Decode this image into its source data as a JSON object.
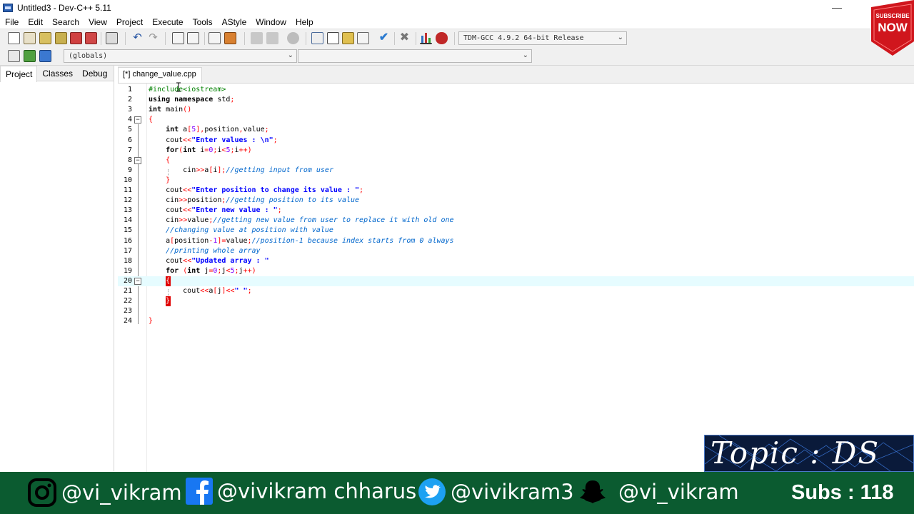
{
  "window": {
    "title": "Untitled3 - Dev-C++ 5.11",
    "minimize_glyph": "—"
  },
  "menu": [
    "File",
    "Edit",
    "Search",
    "View",
    "Project",
    "Execute",
    "Tools",
    "AStyle",
    "Window",
    "Help"
  ],
  "toolbar": {
    "compiler_select": "TDM-GCC 4.9.2 64-bit Release",
    "scope_select": "(globals)",
    "members_select": ""
  },
  "left_panel": {
    "tabs": [
      "Project",
      "Classes",
      "Debug"
    ],
    "active_tab": "Project"
  },
  "editor": {
    "tab_label": "[*] change_value.cpp",
    "current_line": 20,
    "lines": [
      "#include<iostream>",
      "using namespace std;",
      "int main()",
      "{",
      "    int a[5],position,value;",
      "    cout<<\"Enter values : \\n\";",
      "    for(int i=0;i<5;i++)",
      "    {",
      "        cin>>a[i];//getting input from user",
      "    }",
      "    cout<<\"Enter position to change its value : \";",
      "    cin>>position;//getting position to its value",
      "    cout<<\"Enter new value : \";",
      "    cin>>value;//getting new value from user to replace it with old one",
      "    //changing value at position with value",
      "    a[position-1]=value;//position-1 because index starts from 0 always",
      "    //printing whole array",
      "    cout<<\"Updated array : \"",
      "    for (int j=0;j<5;j++)",
      "    {",
      "        cout<<a[j]<<\" \";",
      "    }",
      "",
      "}"
    ]
  },
  "overlay": {
    "subscribe_text": "SUBSCRIBE",
    "subscribe_now": "NOW",
    "topic": "Topic : DS",
    "social": [
      {
        "icon": "instagram-icon",
        "handle": "@vi_vikram"
      },
      {
        "icon": "facebook-icon",
        "handle": "@vivikram chharus"
      },
      {
        "icon": "twitter-icon",
        "handle": "@vivikram3"
      },
      {
        "icon": "snapchat-icon",
        "handle": "@vi_vikram"
      }
    ],
    "subs": "Subs : 118"
  },
  "colors": {
    "keyword": "#000000",
    "string": "#0000ff",
    "comment": "#0066cc",
    "preprocessor": "#008000",
    "number": "#8000ff",
    "operator": "#ff0000",
    "current_line": "#e6fcff",
    "social_bar": "#0b5b30",
    "subscribe_red": "#d0161d"
  }
}
